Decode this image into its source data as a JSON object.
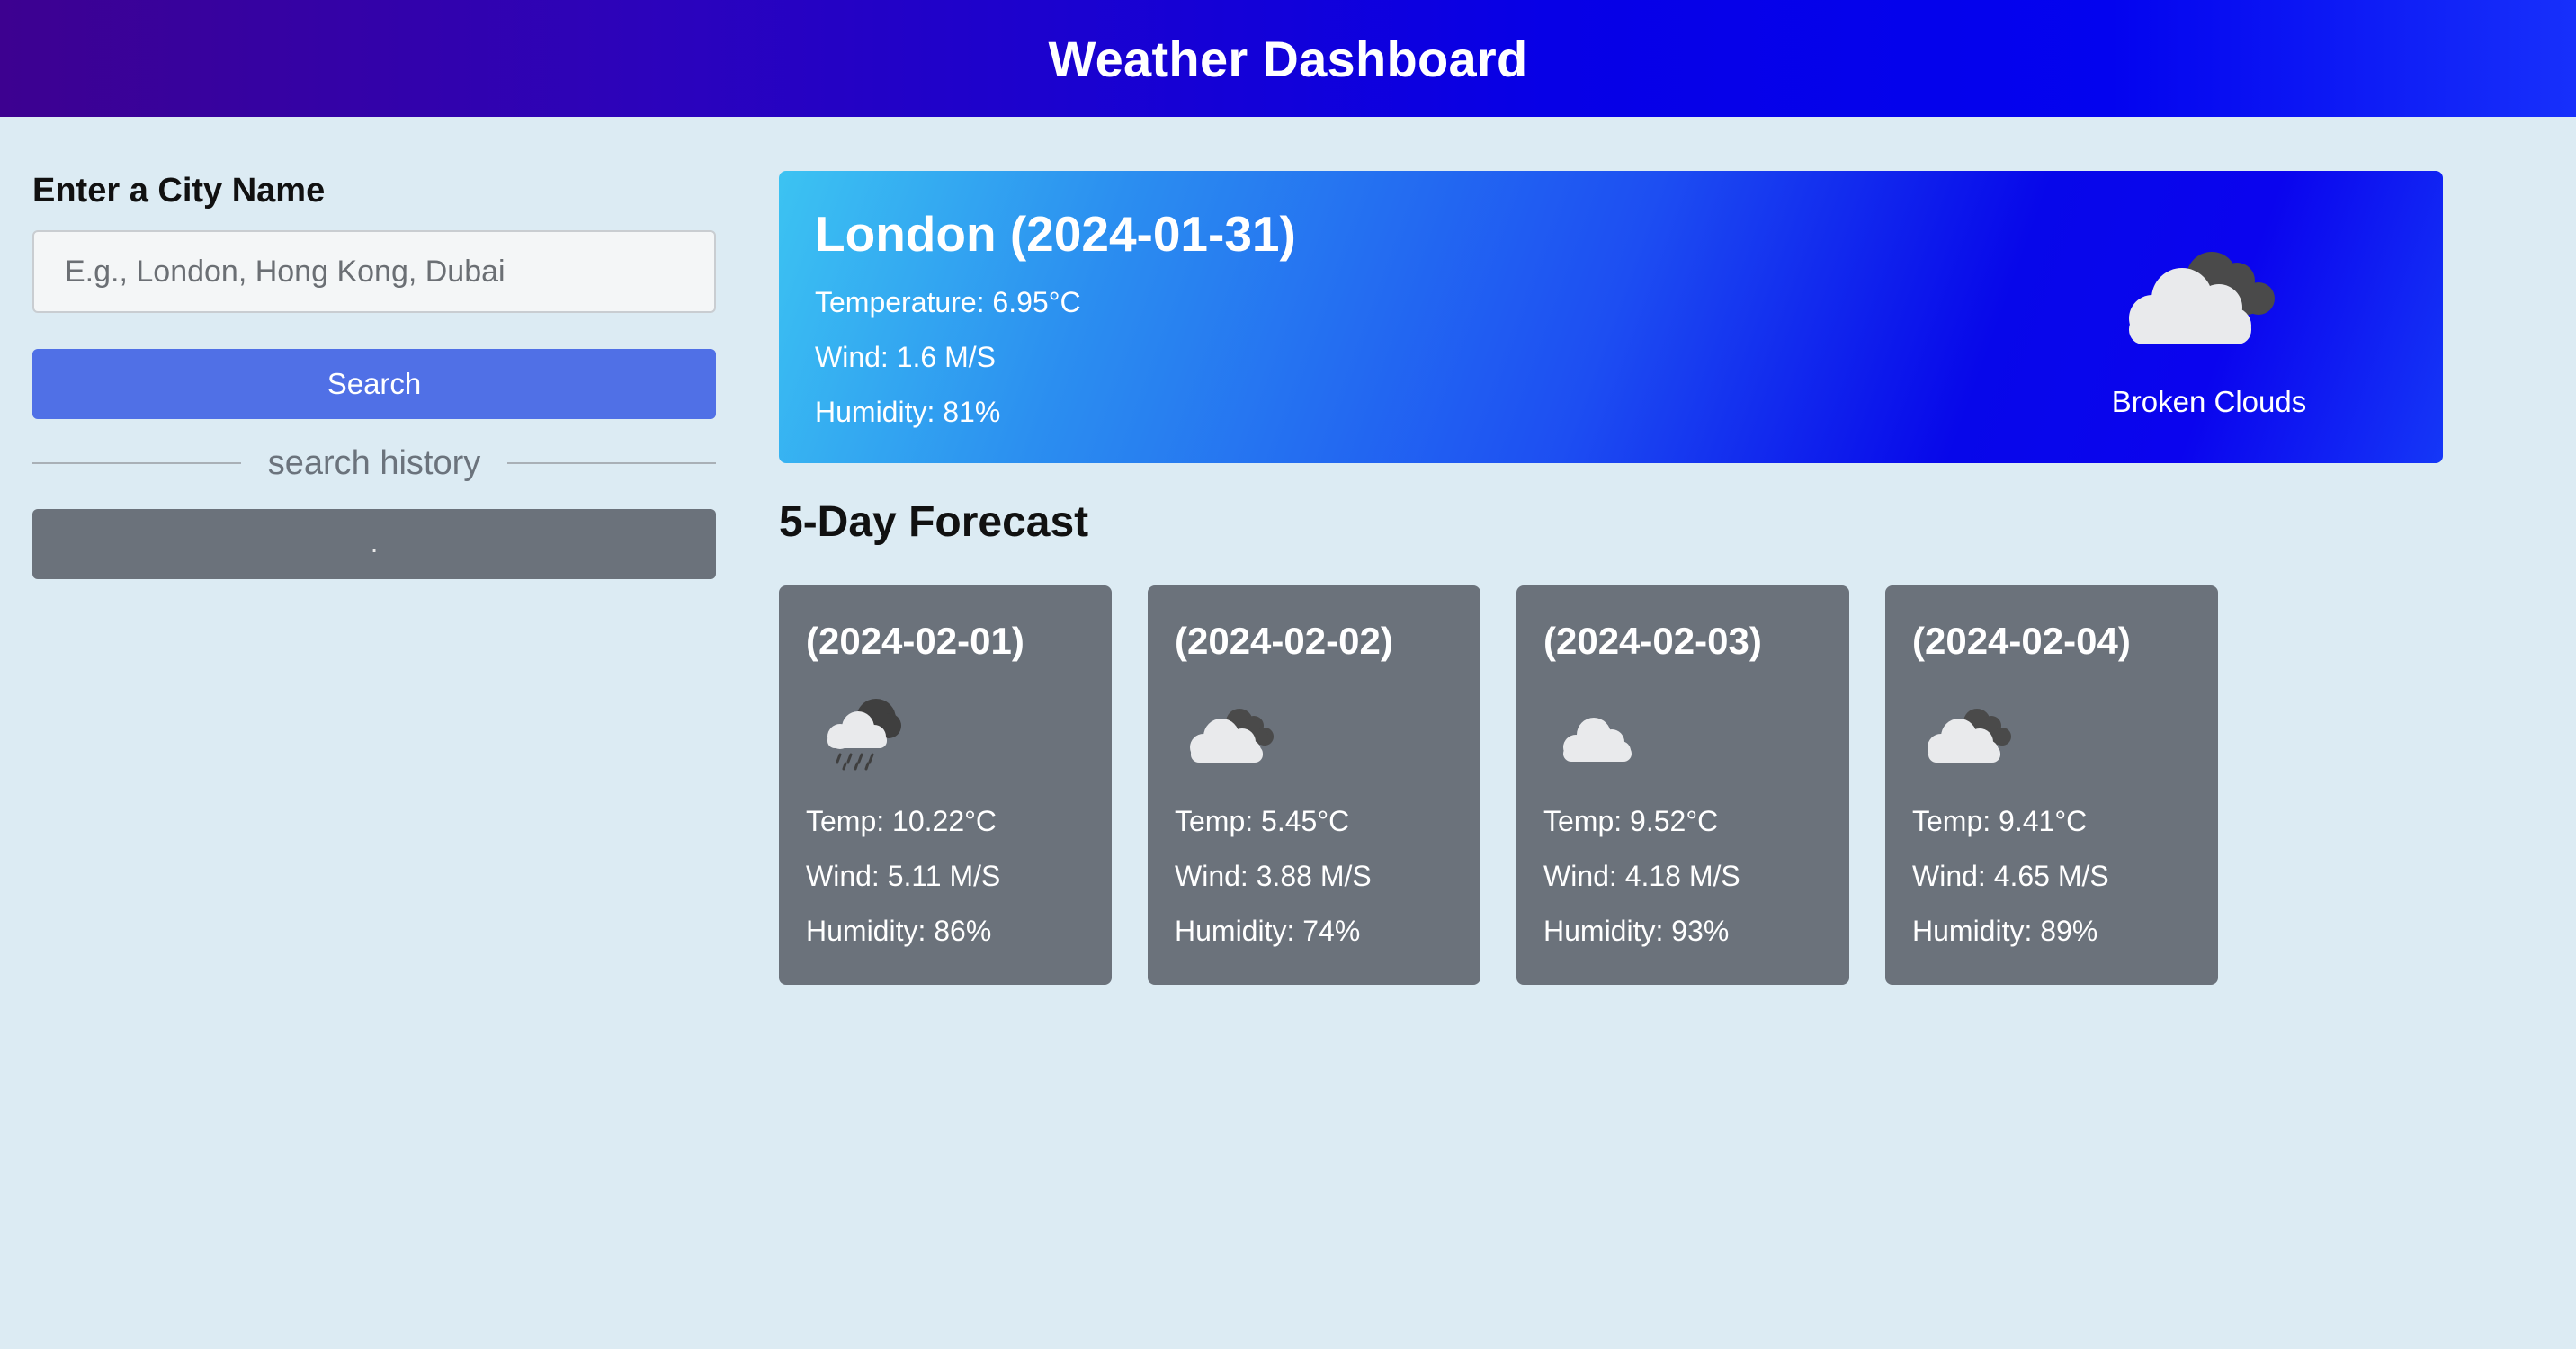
{
  "header": {
    "title": "Weather Dashboard"
  },
  "sidebar": {
    "title": "Enter a City Name",
    "input_value": "",
    "input_placeholder": "E.g., London, Hong Kong, Dubai",
    "search_label": "Search",
    "history_label": "search history",
    "history_items": [
      "."
    ]
  },
  "current": {
    "city_date": "London (2024-01-31)",
    "temperature": "Temperature: 6.95°C",
    "wind": "Wind: 1.6 M/S",
    "humidity": "Humidity: 81%",
    "description": "Broken Clouds",
    "icon": "broken-clouds-icon"
  },
  "forecast": {
    "title": "5-Day Forecast",
    "days": [
      {
        "date": "(2024-02-01)",
        "icon": "rain-icon",
        "temp": "Temp: 10.22°C",
        "wind": "Wind: 5.11 M/S",
        "humidity": "Humidity: 86%"
      },
      {
        "date": "(2024-02-02)",
        "icon": "broken-clouds-icon",
        "temp": "Temp: 5.45°C",
        "wind": "Wind: 3.88 M/S",
        "humidity": "Humidity: 74%"
      },
      {
        "date": "(2024-02-03)",
        "icon": "cloud-icon",
        "temp": "Temp: 9.52°C",
        "wind": "Wind: 4.18 M/S",
        "humidity": "Humidity: 93%"
      },
      {
        "date": "(2024-02-04)",
        "icon": "broken-clouds-icon",
        "temp": "Temp: 9.41°C",
        "wind": "Wind: 4.65 M/S",
        "humidity": "Humidity: 89%"
      }
    ]
  },
  "colors": {
    "page_background": "#dcebf3",
    "search_button": "#5070e6",
    "card_background": "#6b727b"
  }
}
